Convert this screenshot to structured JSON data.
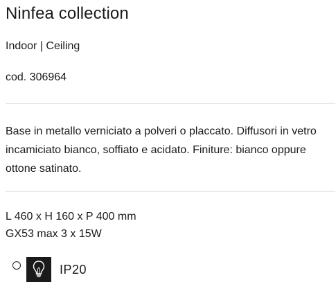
{
  "product": {
    "title": "Ninfea collection",
    "category": "Indoor | Ceiling",
    "code": "cod. 306964",
    "description": "Base in metallo verniciato a polveri o placcato. Diffusori in vetro incamiciato bianco, soffiato e acidato. Finiture: bianco oppure ottone satinato.",
    "dimensions": "L 460 x H 160 x P 400 mm",
    "lamp": "GX53 max 3 x 15W",
    "ip_rating": "IP20"
  },
  "icons": {
    "insulation_class": "class-ii-insulation-icon",
    "bulb": "bulb-icon"
  },
  "colors": {
    "text": "#1a1a1a",
    "divider": "#e4e4e4",
    "icon_bg": "#1a1a1a"
  }
}
